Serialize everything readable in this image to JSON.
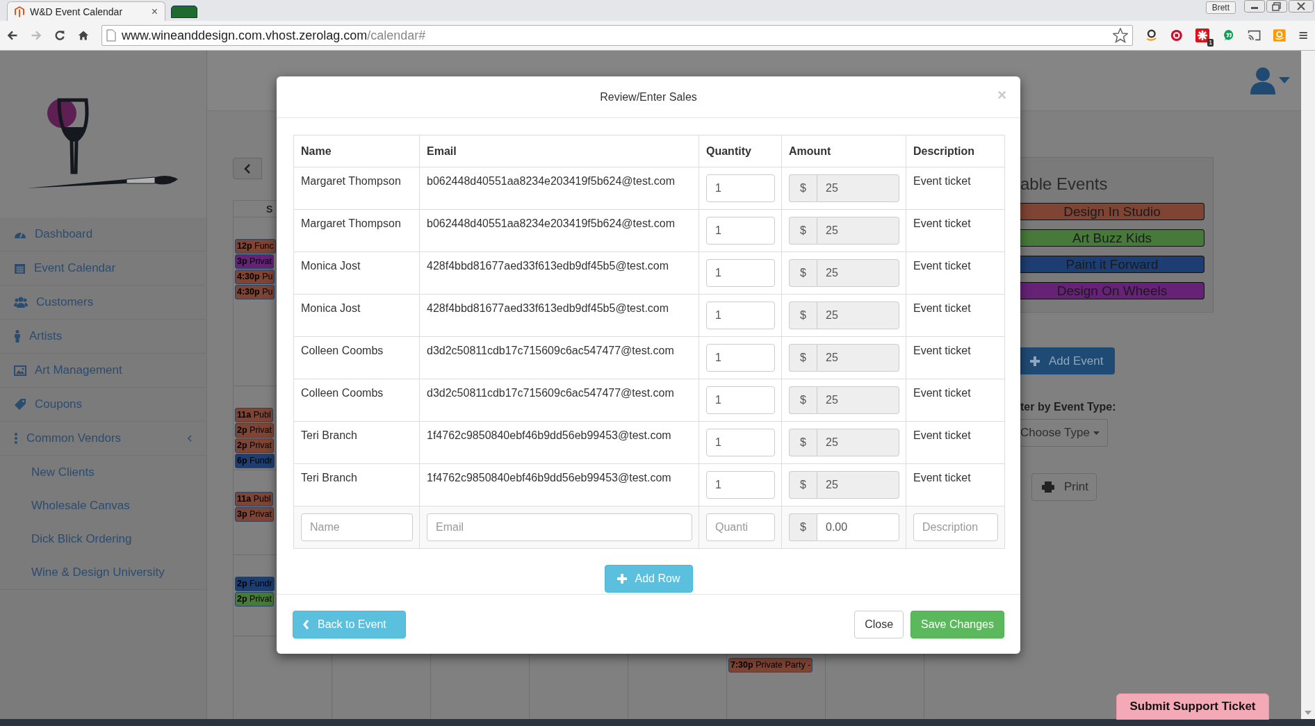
{
  "browser": {
    "tab_title": "W&D Event Calendar",
    "tab_close": "×",
    "url_host": "www.wineanddesign.com.vhost.zerolag.com",
    "url_path": "/calendar#",
    "profile": "Brett",
    "extension_badge": "1"
  },
  "sidebar": {
    "items": [
      {
        "label": "Dashboard"
      },
      {
        "label": "Event Calendar"
      },
      {
        "label": "Customers"
      },
      {
        "label": "Artists"
      },
      {
        "label": "Art Management"
      },
      {
        "label": "Coupons"
      },
      {
        "label": "Common Vendors",
        "expanded": true,
        "children": [
          {
            "label": "New Clients"
          },
          {
            "label": "Wholesale Canvas"
          },
          {
            "label": "Dick Blick Ordering"
          },
          {
            "label": "Wine & Design University"
          }
        ]
      }
    ]
  },
  "calendar": {
    "day_headers": [
      "S"
    ],
    "weeks": [
      {
        "column_1": [
          {
            "text": "**12p** Func",
            "color": "#7f4433"
          },
          {
            "text": "**3p** Privat",
            "color": "#662277"
          },
          {
            "text": "**4:30p** Pu",
            "color": "#7f4433"
          },
          {
            "text": "**4:30p** Pu",
            "color": "#7f4433"
          }
        ]
      },
      {
        "column_1": [
          {
            "text": "**11a** Publ",
            "color": "#7f4433"
          },
          {
            "text": "**2p** Privat",
            "color": "#7f4433"
          },
          {
            "text": "**2p** Privat",
            "color": "#7f4433"
          },
          {
            "text": "**6p** Fundr",
            "color": "#1c3e72"
          }
        ]
      },
      {
        "column_1": [
          {
            "text": "**11a** Publ",
            "color": "#7f4433"
          },
          {
            "text": "**3p** Privat",
            "color": "#7f4433"
          }
        ]
      },
      {
        "column_1": [
          {
            "text": "**2p** Fundr",
            "color": "#1c3e72"
          },
          {
            "text": "**2p** Privat",
            "color": "#477a3a"
          }
        ]
      },
      {
        "column_6": [
          {
            "text": "**7:30p** Private Party -",
            "color": "#7f4433"
          }
        ]
      }
    ]
  },
  "right_panel": {
    "title": "able Events",
    "event_types": [
      {
        "label": "Design In Studio",
        "color": "#7f4433"
      },
      {
        "label": "Art Buzz Kids",
        "color": "#477a3a"
      },
      {
        "label": "Paint it Forward",
        "color": "#1c3e72"
      },
      {
        "label": "Design On Wheels",
        "color": "#662277"
      }
    ],
    "add_event": "Add Event",
    "filter_label": "ter by Event Type:",
    "choose_type": "Choose Type",
    "print": "Print"
  },
  "modal": {
    "title": "Review/Enter Sales",
    "close": "×",
    "columns": [
      "Name",
      "Email",
      "Quantity",
      "Amount",
      "Description"
    ],
    "rows": [
      {
        "name": "Margaret Thompson",
        "email": "b062448d40551aa8234e203419f5b624@test.com",
        "quantity": "1",
        "currency": "$",
        "amount": "25",
        "amount_disabled": true,
        "description": "Event ticket"
      },
      {
        "name": "Margaret Thompson",
        "email": "b062448d40551aa8234e203419f5b624@test.com",
        "quantity": "1",
        "currency": "$",
        "amount": "25",
        "amount_disabled": true,
        "description": "Event ticket"
      },
      {
        "name": "Monica Jost",
        "email": "428f4bbd81677aed33f613edb9df45b5@test.com",
        "quantity": "1",
        "currency": "$",
        "amount": "25",
        "amount_disabled": true,
        "description": "Event ticket"
      },
      {
        "name": "Monica Jost",
        "email": "428f4bbd81677aed33f613edb9df45b5@test.com",
        "quantity": "1",
        "currency": "$",
        "amount": "25",
        "amount_disabled": true,
        "description": "Event ticket"
      },
      {
        "name": "Colleen Coombs",
        "email": "d3d2c50811cdb17c715609c6ac547477@test.com",
        "quantity": "1",
        "currency": "$",
        "amount": "25",
        "amount_disabled": true,
        "description": "Event ticket"
      },
      {
        "name": "Colleen Coombs",
        "email": "d3d2c50811cdb17c715609c6ac547477@test.com",
        "quantity": "1",
        "currency": "$",
        "amount": "25",
        "amount_disabled": true,
        "description": "Event ticket"
      },
      {
        "name": "Teri Branch",
        "email": "1f4762c9850840ebf46b9dd56eb99453@test.com",
        "quantity": "1",
        "currency": "$",
        "amount": "25",
        "amount_disabled": true,
        "description": "Event ticket"
      },
      {
        "name": "Teri Branch",
        "email": "1f4762c9850840ebf46b9dd56eb99453@test.com",
        "quantity": "1",
        "currency": "$",
        "amount": "25",
        "amount_disabled": true,
        "description": "Event ticket"
      }
    ],
    "new_row": {
      "name_placeholder": "Name",
      "email_placeholder": "Email",
      "quantity_placeholder": "Quanti",
      "currency": "$",
      "amount": "0.00",
      "amount_disabled": false,
      "description_placeholder": "Description"
    },
    "add_row": "Add Row",
    "back": "Back to Event",
    "close_button": "Close",
    "save": "Save Changes"
  },
  "support_button": "Submit Support Ticket"
}
